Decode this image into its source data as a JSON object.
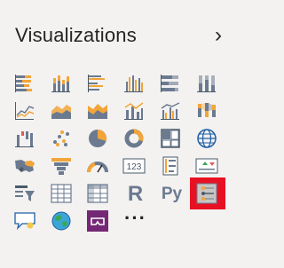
{
  "pane": {
    "title": "Visualizations",
    "collapse_glyph": "›"
  },
  "visuals": {
    "r_label": "R",
    "py_label": "Py",
    "card_label": "123",
    "more_label": "···"
  }
}
